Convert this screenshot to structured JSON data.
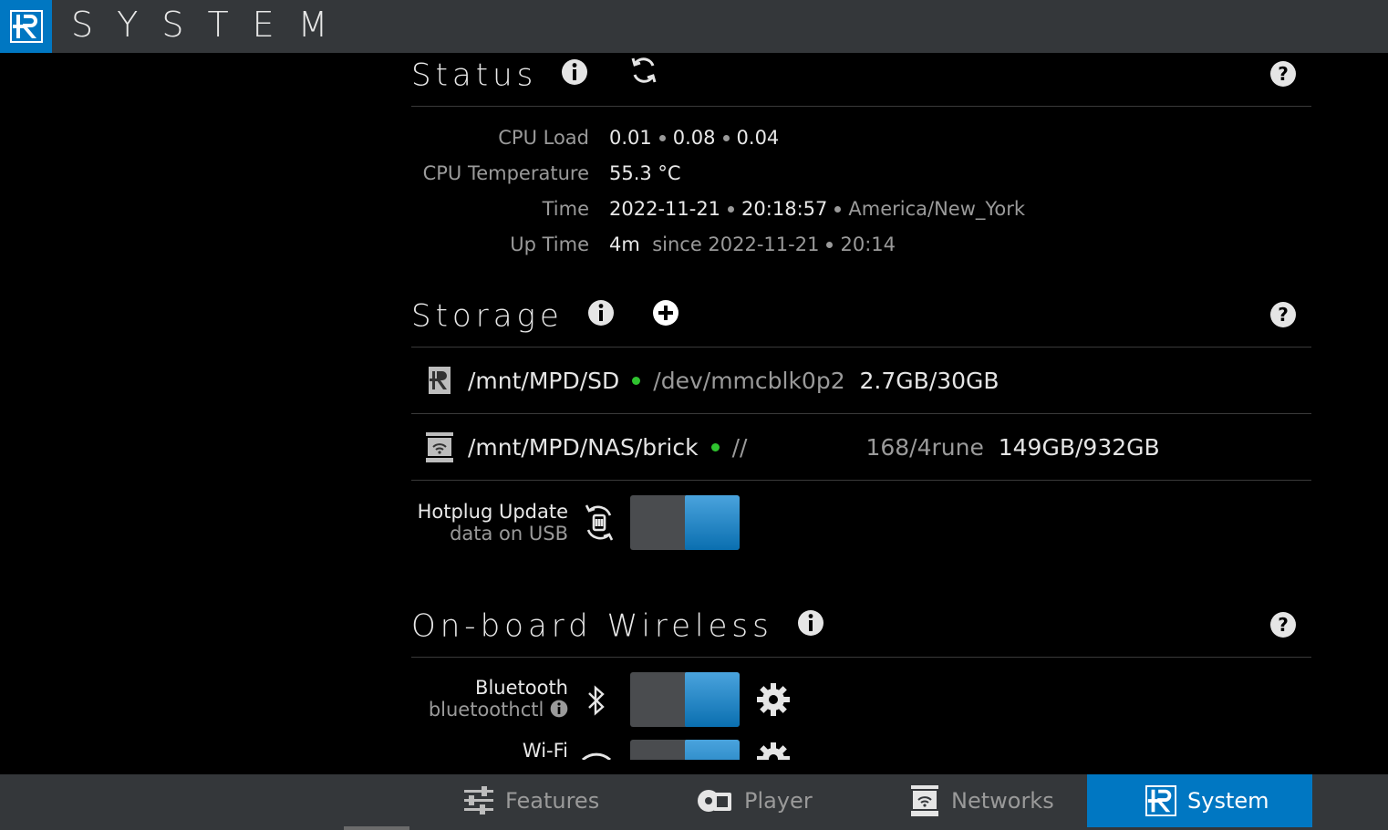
{
  "app": {
    "title": "SYSTEM"
  },
  "status": {
    "title": "Status",
    "rows": {
      "cpu_load": {
        "label": "CPU Load",
        "v1": "0.01",
        "v2": "0.08",
        "v3": "0.04"
      },
      "cpu_temp": {
        "label": "CPU Temperature",
        "value": "55.3 °C"
      },
      "time": {
        "label": "Time",
        "date": "2022-11-21",
        "clock": "20:18:57",
        "zone": "America/New_York"
      },
      "uptime": {
        "label": "Up Time",
        "value": "4m",
        "since": "since 2022-11-21",
        "since_time": "20:14"
      }
    }
  },
  "storage": {
    "title": "Storage",
    "mounts": [
      {
        "path": "/mnt/MPD/SD",
        "source": "/dev/mmcblk0p2",
        "usage": "2.7GB/30GB"
      },
      {
        "path": "/mnt/MPD/NAS/brick",
        "source": "//",
        "source2": "168/4rune",
        "usage": "149GB/932GB"
      }
    ],
    "hotplug": {
      "label": "Hotplug Update",
      "sub": "data on USB",
      "enabled": true
    }
  },
  "wireless": {
    "title": "On-board Wireless",
    "bluetooth": {
      "label": "Bluetooth",
      "sub": "bluetoothctl",
      "enabled": true
    },
    "wifi": {
      "label": "Wi-Fi",
      "enabled": true
    }
  },
  "tabs": [
    {
      "label": "Features",
      "icon": "sliders-icon"
    },
    {
      "label": "Player",
      "icon": "player-icon"
    },
    {
      "label": "Networks",
      "icon": "networks-icon"
    },
    {
      "label": "System",
      "icon": "system-logo-icon",
      "active": true
    }
  ],
  "colors": {
    "accent": "#0077c2",
    "status_ok": "#2fc32f",
    "bar": "#34373a"
  }
}
